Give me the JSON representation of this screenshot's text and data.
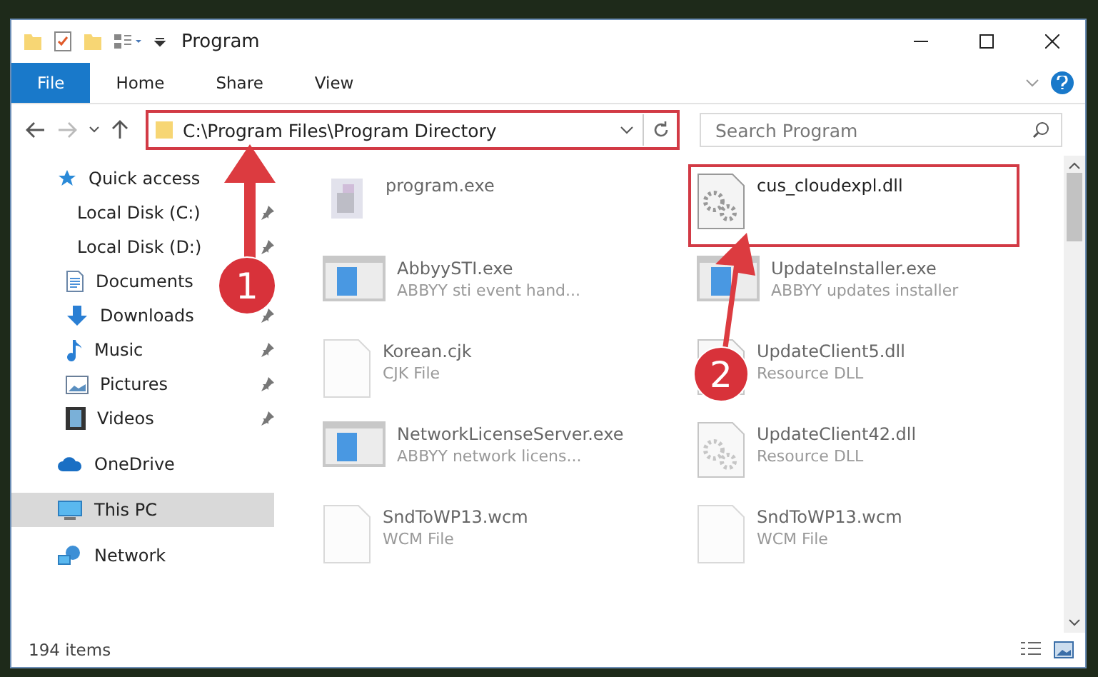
{
  "window": {
    "title": "Program"
  },
  "ribbon_tabs": [
    {
      "label": "File",
      "selected": true
    },
    {
      "label": "Home",
      "selected": false
    },
    {
      "label": "Share",
      "selected": false
    },
    {
      "label": "View",
      "selected": false
    }
  ],
  "address": {
    "path": "C:\\Program Files\\Program Directory",
    "highlighted": true
  },
  "search": {
    "placeholder": "Search Program"
  },
  "sidebar": {
    "items": [
      {
        "label": "Quick access",
        "kind": "star",
        "selected": false,
        "pinned": false,
        "children": [
          {
            "label": "Local Disk (C:)",
            "kind": "disk",
            "selected": false,
            "pinned": true
          },
          {
            "label": "Local Disk (D:)",
            "kind": "disk",
            "selected": false,
            "pinned": true
          },
          {
            "label": "Documents",
            "kind": "doc",
            "selected": false,
            "pinned": false
          },
          {
            "label": "Downloads",
            "kind": "download",
            "selected": false,
            "pinned": true
          },
          {
            "label": "Music",
            "kind": "music",
            "selected": false,
            "pinned": true
          },
          {
            "label": "Pictures",
            "kind": "pictures",
            "selected": false,
            "pinned": true
          },
          {
            "label": "Videos",
            "kind": "video",
            "selected": false,
            "pinned": true
          }
        ]
      },
      {
        "label": "OneDrive",
        "kind": "cloud",
        "selected": false,
        "pinned": false
      },
      {
        "label": "This PC",
        "kind": "pc",
        "selected": true,
        "pinned": false
      },
      {
        "label": "Network",
        "kind": "network",
        "selected": false,
        "pinned": false
      }
    ]
  },
  "files": [
    {
      "name": "program.exe",
      "kind": "installer",
      "highlighted": false
    },
    {
      "name": "cus_cloudexpl.dll",
      "kind": "dll",
      "highlighted": true
    },
    {
      "name": "AbbyySTI.exe",
      "type": "ABBYY sti event hand...",
      "kind": "app",
      "highlighted": false
    },
    {
      "name": "UpdateInstaller.exe",
      "type": "ABBYY updates installer",
      "kind": "app",
      "highlighted": false
    },
    {
      "name": "Korean.cjk",
      "type": "CJK File",
      "kind": "blank",
      "highlighted": false
    },
    {
      "name": "UpdateClient5.dll",
      "type": "Resource DLL",
      "kind": "dll",
      "highlighted": false
    },
    {
      "name": "NetworkLicenseServer.exe",
      "type": "ABBYY network licens...",
      "kind": "app",
      "highlighted": false
    },
    {
      "name": "UpdateClient42.dll",
      "type": "Resource DLL",
      "kind": "dll",
      "highlighted": false
    },
    {
      "name": "SndToWP13.wcm",
      "type": "WCM File",
      "kind": "blank",
      "highlighted": false
    },
    {
      "name": "SndToWP13.wcm",
      "type": "WCM File",
      "kind": "blank",
      "highlighted": false
    }
  ],
  "status_bar": {
    "count": "194 items"
  },
  "callouts": [
    "1",
    "2"
  ]
}
